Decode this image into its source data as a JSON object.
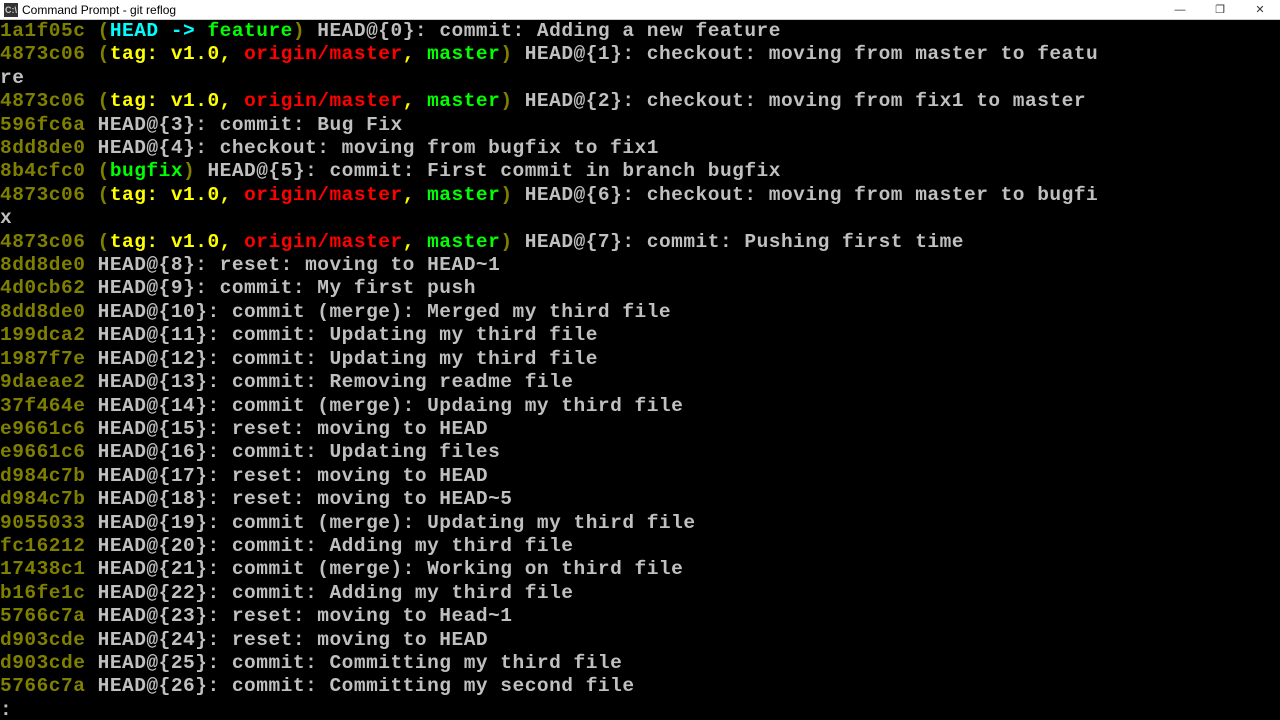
{
  "window": {
    "title": "Command Prompt - git  reflog",
    "icon_label": "C:\\"
  },
  "colors": {
    "hash": "#808000",
    "white": "#c0c0c0",
    "cyan": "#00ffff",
    "green": "#00ff00",
    "red": "#ff0000",
    "tag_yellow": "#ffff00"
  },
  "reflog": [
    {
      "hash": "1a1f05c",
      "refs": {
        "open": "(",
        "parts": [
          {
            "t": "HEAD -> ",
            "c": "cyan"
          },
          {
            "t": "feature",
            "c": "green"
          }
        ],
        "close": ")"
      },
      "head": "HEAD@{0}",
      "sep": ": ",
      "msg": "commit: Adding a new feature"
    },
    {
      "hash": "4873c06",
      "refs": {
        "open": "(",
        "parts": [
          {
            "t": "tag: v1.0",
            "c": "tag"
          },
          {
            "t": ", ",
            "c": "tag"
          },
          {
            "t": "origin/master",
            "c": "red"
          },
          {
            "t": ", ",
            "c": "tag"
          },
          {
            "t": "master",
            "c": "green"
          }
        ],
        "close": ")"
      },
      "head": "HEAD@{1}",
      "sep": ": ",
      "msg": "checkout: moving from master to feature",
      "wrap": true
    },
    {
      "hash": "4873c06",
      "refs": {
        "open": "(",
        "parts": [
          {
            "t": "tag: v1.0",
            "c": "tag"
          },
          {
            "t": ", ",
            "c": "tag"
          },
          {
            "t": "origin/master",
            "c": "red"
          },
          {
            "t": ", ",
            "c": "tag"
          },
          {
            "t": "master",
            "c": "green"
          }
        ],
        "close": ")"
      },
      "head": "HEAD@{2}",
      "sep": ": ",
      "msg": "checkout: moving from fix1 to master"
    },
    {
      "hash": "596fc6a",
      "head": "HEAD@{3}",
      "sep": ": ",
      "msg": "commit: Bug Fix"
    },
    {
      "hash": "8dd8de0",
      "head": "HEAD@{4}",
      "sep": ": ",
      "msg": "checkout: moving from bugfix to fix1"
    },
    {
      "hash": "8b4cfc0",
      "refs": {
        "open": "(",
        "parts": [
          {
            "t": "bugfix",
            "c": "green"
          }
        ],
        "close": ")"
      },
      "head": "HEAD@{5}",
      "sep": ": ",
      "msg": "commit: First commit in branch bugfix"
    },
    {
      "hash": "4873c06",
      "refs": {
        "open": "(",
        "parts": [
          {
            "t": "tag: v1.0",
            "c": "tag"
          },
          {
            "t": ", ",
            "c": "tag"
          },
          {
            "t": "origin/master",
            "c": "red"
          },
          {
            "t": ", ",
            "c": "tag"
          },
          {
            "t": "master",
            "c": "green"
          }
        ],
        "close": ")"
      },
      "head": "HEAD@{6}",
      "sep": ": ",
      "msg": "checkout: moving from master to bugfix",
      "wrap": true
    },
    {
      "hash": "4873c06",
      "refs": {
        "open": "(",
        "parts": [
          {
            "t": "tag: v1.0",
            "c": "tag"
          },
          {
            "t": ", ",
            "c": "tag"
          },
          {
            "t": "origin/master",
            "c": "red"
          },
          {
            "t": ", ",
            "c": "tag"
          },
          {
            "t": "master",
            "c": "green"
          }
        ],
        "close": ")"
      },
      "head": "HEAD@{7}",
      "sep": ": ",
      "msg": "commit: Pushing first time"
    },
    {
      "hash": "8dd8de0",
      "head": "HEAD@{8}",
      "sep": ": ",
      "msg": "reset: moving to HEAD~1"
    },
    {
      "hash": "4d0cb62",
      "head": "HEAD@{9}",
      "sep": ": ",
      "msg": "commit: My first push"
    },
    {
      "hash": "8dd8de0",
      "head": "HEAD@{10}",
      "sep": ": ",
      "msg": "commit (merge): Merged my third file"
    },
    {
      "hash": "199dca2",
      "head": "HEAD@{11}",
      "sep": ": ",
      "msg": "commit: Updating my third file"
    },
    {
      "hash": "1987f7e",
      "head": "HEAD@{12}",
      "sep": ": ",
      "msg": "commit: Updating my third file"
    },
    {
      "hash": "9daeae2",
      "head": "HEAD@{13}",
      "sep": ": ",
      "msg": "commit: Removing readme file"
    },
    {
      "hash": "37f464e",
      "head": "HEAD@{14}",
      "sep": ": ",
      "msg": "commit (merge): Updaing my third file"
    },
    {
      "hash": "e9661c6",
      "head": "HEAD@{15}",
      "sep": ": ",
      "msg": "reset: moving to HEAD"
    },
    {
      "hash": "e9661c6",
      "head": "HEAD@{16}",
      "sep": ": ",
      "msg": "commit: Updating files"
    },
    {
      "hash": "d984c7b",
      "head": "HEAD@{17}",
      "sep": ": ",
      "msg": "reset: moving to HEAD"
    },
    {
      "hash": "d984c7b",
      "head": "HEAD@{18}",
      "sep": ": ",
      "msg": "reset: moving to HEAD~5"
    },
    {
      "hash": "9055033",
      "head": "HEAD@{19}",
      "sep": ": ",
      "msg": "commit (merge): Updating my third file"
    },
    {
      "hash": "fc16212",
      "head": "HEAD@{20}",
      "sep": ": ",
      "msg": "commit: Adding my third file"
    },
    {
      "hash": "17438c1",
      "head": "HEAD@{21}",
      "sep": ": ",
      "msg": "commit (merge): Working on third file"
    },
    {
      "hash": "b16fe1c",
      "head": "HEAD@{22}",
      "sep": ": ",
      "msg": "commit: Adding my third file"
    },
    {
      "hash": "5766c7a",
      "head": "HEAD@{23}",
      "sep": ": ",
      "msg": "reset: moving to Head~1"
    },
    {
      "hash": "d903cde",
      "head": "HEAD@{24}",
      "sep": ": ",
      "msg": "reset: moving to HEAD"
    },
    {
      "hash": "d903cde",
      "head": "HEAD@{25}",
      "sep": ": ",
      "msg": "commit: Committing my third file"
    },
    {
      "hash": "5766c7a",
      "head": "HEAD@{26}",
      "sep": ": ",
      "msg": "commit: Committing my second file"
    }
  ],
  "pager_prompt": ":"
}
